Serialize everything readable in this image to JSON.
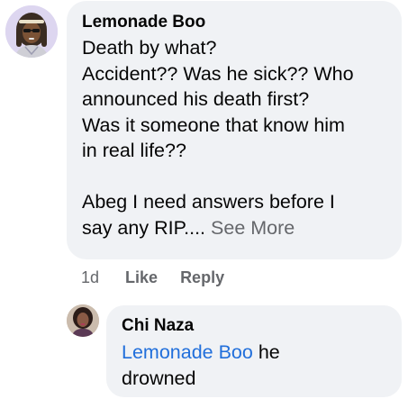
{
  "comment": {
    "author": "Lemonade Boo",
    "lines": [
      "Death by what?",
      "Accident?? Was he sick?? Who",
      "announced his death first?",
      "Was it someone that know him",
      "in real life??"
    ],
    "last_line": "Abeg I need answers before I",
    "truncated_line": "say any RIP....",
    "see_more_label": "See More",
    "time": "1d",
    "like_label": "Like",
    "reply_label": "Reply"
  },
  "reply": {
    "author": "Chi Naza",
    "mention": "Lemonade Boo",
    "text_after_mention": " he",
    "text_line2": "drowned"
  },
  "colors": {
    "bubble": "#f0f2f5",
    "text": "#050505",
    "muted": "#65676b",
    "mention": "#216fdb"
  },
  "icons": {
    "main_avatar": "avatar-icon",
    "reply_avatar": "avatar-icon"
  }
}
